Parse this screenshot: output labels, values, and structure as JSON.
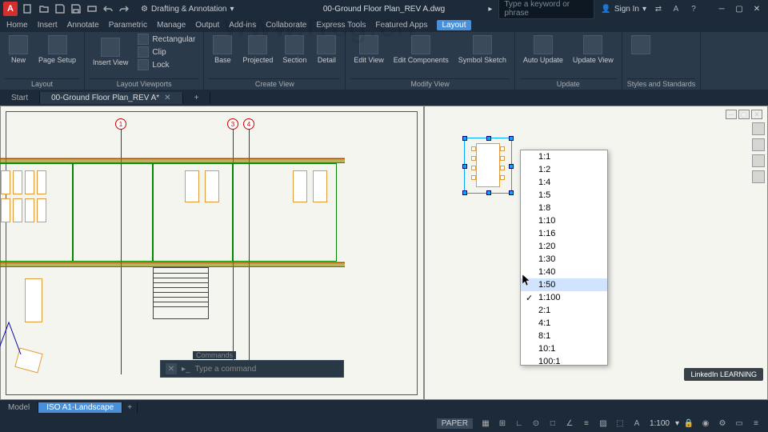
{
  "title": "00-Ground Floor Plan_REV A.dwg",
  "workspace": "Drafting & Annotation",
  "search_placeholder": "Type a keyword or phrase",
  "signin": "Sign In",
  "menu": [
    "Home",
    "Insert",
    "Annotate",
    "Parametric",
    "Manage",
    "Output",
    "Add-ins",
    "Collaborate",
    "Express Tools",
    "Featured Apps",
    "Layout"
  ],
  "active_menu": 10,
  "ribbon": {
    "panels": [
      {
        "label": "Layout",
        "big": [
          {
            "t": "New"
          },
          {
            "t": "Page\nSetup"
          }
        ]
      },
      {
        "label": "Layout Viewports",
        "big": [
          {
            "t": "Insert View"
          }
        ],
        "small": [
          "Rectangular",
          "Clip",
          "Lock"
        ]
      },
      {
        "label": "Create View",
        "big": [
          {
            "t": "Base"
          },
          {
            "t": "Projected"
          },
          {
            "t": "Section"
          },
          {
            "t": "Detail"
          }
        ]
      },
      {
        "label": "Modify View",
        "big": [
          {
            "t": "Edit\nView"
          },
          {
            "t": "Edit\nComponents"
          },
          {
            "t": "Symbol\nSketch"
          }
        ]
      },
      {
        "label": "Update",
        "big": [
          {
            "t": "Auto\nUpdate"
          },
          {
            "t": "Update\nView"
          }
        ]
      },
      {
        "label": "Styles and Standards",
        "big": [
          {
            "t": ""
          }
        ]
      }
    ]
  },
  "doctabs": [
    "Start",
    "00-Ground Floor Plan_REV A*"
  ],
  "active_doctab": 1,
  "scale_options": [
    "1:1",
    "1:2",
    "1:4",
    "1:5",
    "1:8",
    "1:10",
    "1:16",
    "1:20",
    "1:30",
    "1:40",
    "1:50",
    "1:100",
    "2:1",
    "4:1",
    "8:1",
    "10:1",
    "100:1"
  ],
  "scale_highlight": "1:50",
  "scale_checked": "1:100",
  "grid_bubbles": [
    "1",
    "3",
    "4"
  ],
  "cmdhist": "Commands",
  "cmdprompt": "Type a command",
  "layout_tabs": [
    "Model",
    "ISO A1-Landscape"
  ],
  "active_layout": 1,
  "status": {
    "paper": "PAPER",
    "scale": "1:100"
  },
  "learning": "LinkedIn LEARNING"
}
